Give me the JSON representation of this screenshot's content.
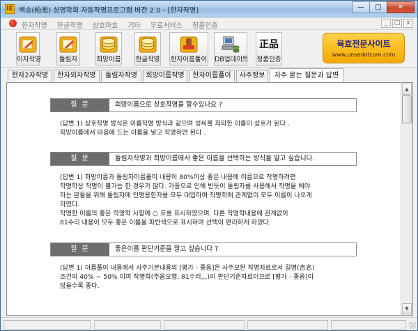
{
  "window": {
    "title": "백송(柏淞) 성명학회 자동작명프로그램 버전 2.0 - [한자작명]",
    "app_icon_glyph": "IE"
  },
  "menu": {
    "items": [
      "한자작명",
      "한글작명",
      "상호아호",
      "기타",
      "무료서비스",
      "정품인증"
    ]
  },
  "toolbar": {
    "buttons": [
      {
        "label": "이자작명",
        "icon": "pencil-paper-icon"
      },
      {
        "label": "돌림자",
        "icon": "pencil-paper-icon"
      },
      {
        "label": "희망이름",
        "icon": "coin-stack-icon"
      },
      {
        "label": "한글작명",
        "icon": "coin-stack-icon"
      },
      {
        "label": "한자이름풀이",
        "icon": "stamp-icon"
      },
      {
        "label": "DB업데이트",
        "icon": "database-computer-icon"
      },
      {
        "label": "정품인증",
        "icon": "hanja-seal-icon",
        "glyph": "正品"
      }
    ],
    "ad": {
      "title": "육효전문사이트",
      "url": "www.unsedatcom.com"
    }
  },
  "tabs": [
    {
      "label": "한자2자작명",
      "active": false
    },
    {
      "label": "한자외자작명",
      "active": false
    },
    {
      "label": "돌림자작명",
      "active": false
    },
    {
      "label": "희망이름작명",
      "active": false
    },
    {
      "label": "한자이름풀이",
      "active": false
    },
    {
      "label": "사주정보",
      "active": false
    },
    {
      "label": "자주 묻는 질문과 답변",
      "active": true
    }
  ],
  "faq": {
    "question_label": "질 문",
    "items": [
      {
        "question": "희망이름으로 상호작명을 할수있나요 ?",
        "answer": "(답변 1) 상호작명 방식은 이름작명 방식과 같으며 성씨를 최외한 이름이 상호가 된다 .\n희망이름에서 마음에 드는 이름을 넣고 작명하면 된다 ."
      },
      {
        "question": "돌림자작명과 희망이름에서 좋은 이름을 선택하는 방식을 알고 싶습니다.",
        "answer": "(답변 1) 희망이름과 돌림자이름풀이 내용이 80%이상 좋은 내용에 이름으로 작명하려면\n작명학상 작명이 불가능 한 경우가 많다. 가풍으로 인해 반듯이 돌림자를 사용해서 작명을 해야\n하는 분들을 위해 돌림자에 인명용한자를 모두 대입하여 작명학에 관계없이 모두 이름이 나오게\n하였다.\n작명한 이름의 좋은 작명학 사항에 ○ 표를 표시하였으며. 다른 작명학내용에 관계없이\n81수리 내용이 모두 좋은 이름을 파란색으로 표시하여 선택이 편리하게 하였다."
      },
      {
        "question": "좋은이름 판단기준을 알고 싶습니다 ?",
        "answer": "(답변 1) 이름풀이 내용에서 사주기본내용의 [평가 - 좋음]은 사주보완 작명자료로서 길명(吉名)\n조건의 40% ~ 50% 이며 작명학(주음오행, 81수리,,,)이 판단기준자료이므로 [평가 - 좋음]이\n많을수록 좋다."
      }
    ]
  },
  "colors": {
    "question_label_bg": "#6d6d6d",
    "ad_bg": "#f5a800",
    "ad_title": "#1b1b80"
  }
}
